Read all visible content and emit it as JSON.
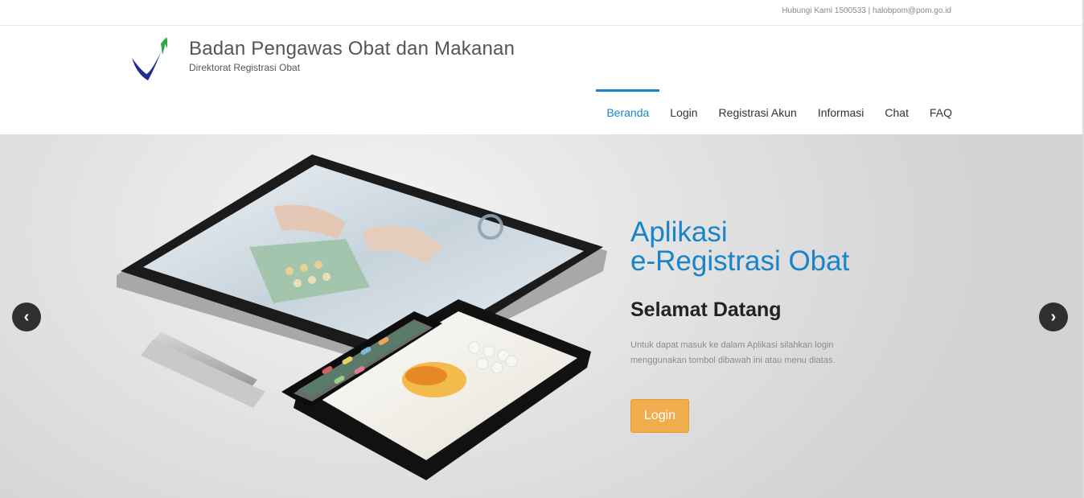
{
  "topbar": {
    "contact": "Hubungi Kami 1500533 | halobpom@pom.go.id"
  },
  "brand": {
    "title": "Badan Pengawas Obat dan Makanan",
    "subtitle": "Direktorat Registrasi Obat",
    "logo_colors": [
      "#1f2f8f",
      "#2aa84a"
    ]
  },
  "nav": {
    "items": [
      {
        "label": "Beranda",
        "active": true
      },
      {
        "label": "Login"
      },
      {
        "label": "Registrasi Akun"
      },
      {
        "label": "Informasi"
      },
      {
        "label": "Chat"
      },
      {
        "label": "FAQ"
      }
    ],
    "accent": "#1a84c7"
  },
  "hero": {
    "title_line1": "Aplikasi",
    "title_line2": "e-Registrasi Obat",
    "welcome": "Selamat Datang",
    "text": "Untuk dapat masuk ke dalam Aplikasi silahkan login menggunakan tombol dibawah ini atau menu diatas.",
    "button_label": "Login",
    "button_color": "#f0ad4e",
    "prev_icon": "chevron-left-icon",
    "next_icon": "chevron-right-icon"
  }
}
